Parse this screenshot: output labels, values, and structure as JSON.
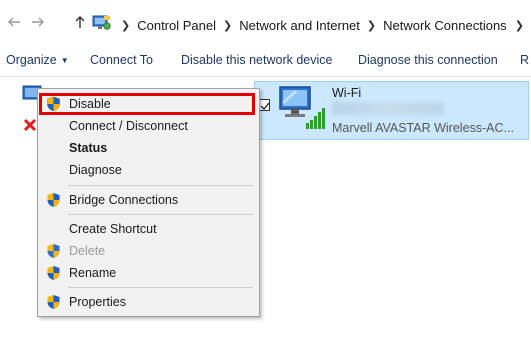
{
  "address_bar": {
    "breadcrumbs": [
      "Control Panel",
      "Network and Internet",
      "Network Connections"
    ],
    "icons": {
      "back": "back-arrow-icon",
      "forward": "forward-arrow-icon",
      "up": "up-arrow-icon",
      "location": "control-panel-icon"
    }
  },
  "command_bar": {
    "organize": "Organize",
    "connect_to": "Connect To",
    "disable_device": "Disable this network device",
    "diagnose": "Diagnose this connection",
    "overflow": "R"
  },
  "wifi_adapter": {
    "name": "Wi-Fi",
    "description": "Marvell AVASTAR Wireless-AC...",
    "selected": true,
    "icon": "wifi-adapter-icon"
  },
  "ethernet_adapter": {
    "icon": "network-adapter-icon",
    "status_icon": "disconnected-x-icon"
  },
  "context_menu": {
    "items": [
      {
        "label": "Disable",
        "shield": true,
        "highlighted": true
      },
      {
        "label": "Connect / Disconnect",
        "shield": false
      },
      {
        "label": "Status",
        "shield": false,
        "bold": true
      },
      {
        "label": "Diagnose",
        "shield": false
      },
      {
        "label": "Bridge Connections",
        "shield": true
      },
      {
        "label": "Create Shortcut",
        "shield": false
      },
      {
        "label": "Delete",
        "shield": true,
        "disabled": true
      },
      {
        "label": "Rename",
        "shield": true
      },
      {
        "label": "Properties",
        "shield": true
      }
    ]
  },
  "colors": {
    "selection_fill": "#cce8ff",
    "selection_border": "#99d1ff",
    "highlight_box": "#e00000",
    "menu_bg": "#f2f2f2",
    "command_text": "#1e3960"
  }
}
